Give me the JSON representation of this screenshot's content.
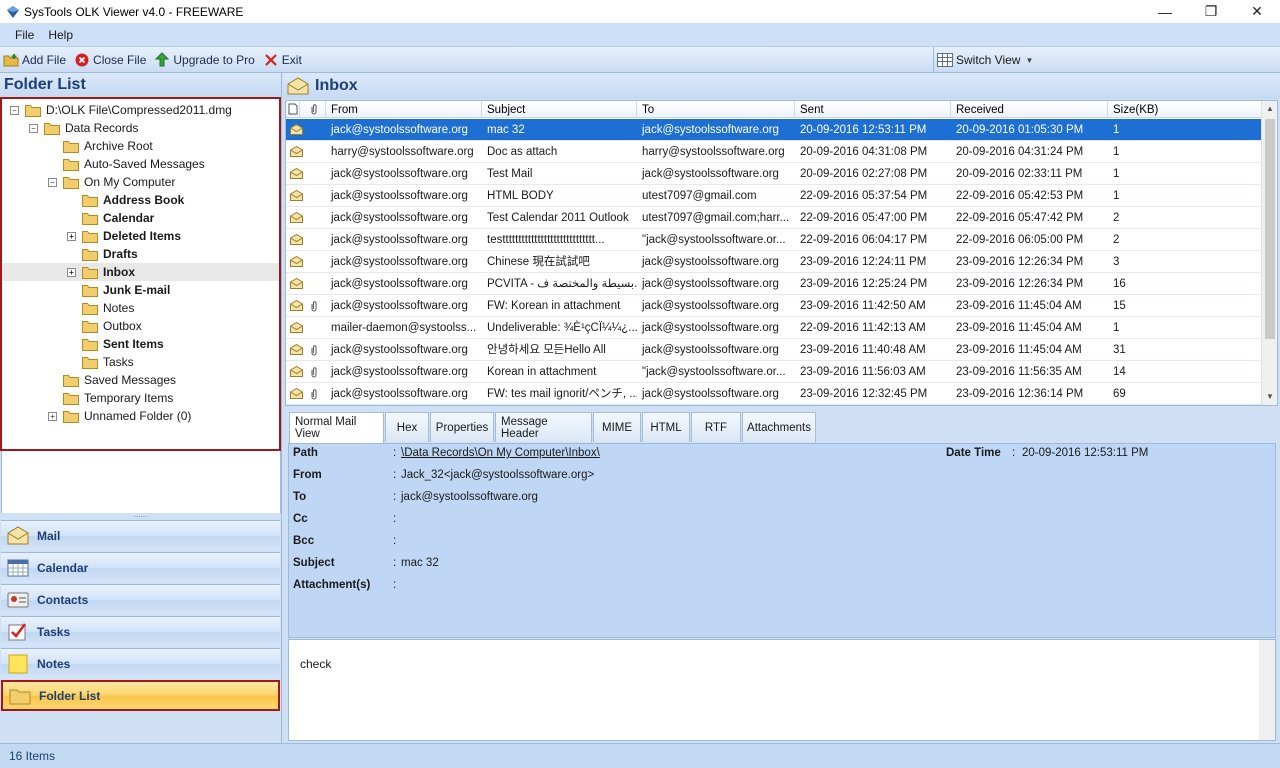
{
  "window": {
    "title": "SysTools OLK Viewer v4.0 - FREEWARE",
    "controls": [
      "—",
      "❐",
      "✕"
    ]
  },
  "menu": [
    "File",
    "Help"
  ],
  "toolbar": {
    "add_file": "Add File",
    "close_file": "Close File",
    "upgrade": "Upgrade to Pro",
    "exit": "Exit",
    "switch_view": "Switch View"
  },
  "folder_list": {
    "title": "Folder List",
    "items": [
      {
        "label": "D:\\OLK File\\Compressed2011.dmg",
        "level": 0,
        "expander": "−",
        "bold": false
      },
      {
        "label": "Data Records",
        "level": 1,
        "expander": "−",
        "bold": false
      },
      {
        "label": "Archive Root",
        "level": 2,
        "expander": "",
        "bold": false
      },
      {
        "label": "Auto-Saved Messages",
        "level": 2,
        "expander": "",
        "bold": false
      },
      {
        "label": "On My Computer",
        "level": 2,
        "expander": "−",
        "bold": false
      },
      {
        "label": "Address Book",
        "level": 3,
        "expander": "",
        "bold": true
      },
      {
        "label": "Calendar",
        "level": 3,
        "expander": "",
        "bold": true
      },
      {
        "label": "Deleted Items",
        "level": 3,
        "expander": "+",
        "bold": true
      },
      {
        "label": "Drafts",
        "level": 3,
        "expander": "",
        "bold": true
      },
      {
        "label": "Inbox",
        "level": 3,
        "expander": "+",
        "bold": true,
        "selected": true
      },
      {
        "label": "Junk E-mail",
        "level": 3,
        "expander": "",
        "bold": true
      },
      {
        "label": "Notes",
        "level": 3,
        "expander": "",
        "bold": false
      },
      {
        "label": "Outbox",
        "level": 3,
        "expander": "",
        "bold": false
      },
      {
        "label": "Sent Items",
        "level": 3,
        "expander": "",
        "bold": true
      },
      {
        "label": "Tasks",
        "level": 3,
        "expander": "",
        "bold": false
      },
      {
        "label": "Saved Messages",
        "level": 2,
        "expander": "",
        "bold": false
      },
      {
        "label": "Temporary Items",
        "level": 2,
        "expander": "",
        "bold": false
      },
      {
        "label": "Unnamed Folder (0)",
        "level": 2,
        "expander": "+",
        "bold": false
      }
    ]
  },
  "nav": {
    "splitter": "......",
    "buttons": [
      "Mail",
      "Calendar",
      "Contacts",
      "Tasks",
      "Notes",
      "Folder List"
    ],
    "active": "Folder List"
  },
  "inbox": {
    "title": "Inbox",
    "columns": [
      "From",
      "Subject",
      "To",
      "Sent",
      "Received",
      "Size(KB)"
    ],
    "rows": [
      {
        "from": "jack@systoolssoftware.org",
        "subject": "mac 32",
        "to": "jack@systoolssoftware.org",
        "sent": "20-09-2016 12:53:11 PM",
        "received": "20-09-2016 01:05:30 PM",
        "size": "1",
        "attach": false
      },
      {
        "from": "harry@systoolssoftware.org",
        "subject": "Doc as attach",
        "to": "harry@systoolssoftware.org",
        "sent": "20-09-2016 04:31:08 PM",
        "received": "20-09-2016 04:31:24 PM",
        "size": "1",
        "attach": false
      },
      {
        "from": "jack@systoolssoftware.org",
        "subject": "Test Mail",
        "to": "jack@systoolssoftware.org",
        "sent": "20-09-2016 02:27:08 PM",
        "received": "20-09-2016 02:33:11 PM",
        "size": "1",
        "attach": false
      },
      {
        "from": "jack@systoolssoftware.org",
        "subject": "HTML BODY",
        "to": "utest7097@gmail.com",
        "sent": "22-09-2016 05:37:54 PM",
        "received": "22-09-2016 05:42:53 PM",
        "size": "1",
        "attach": false
      },
      {
        "from": "jack@systoolssoftware.org",
        "subject": "Test Calendar 2011 Outlook",
        "to": "utest7097@gmail.com;harr...",
        "sent": "22-09-2016 05:47:00 PM",
        "received": "22-09-2016 05:47:42 PM",
        "size": "2",
        "attach": false
      },
      {
        "from": "jack@systoolssoftware.org",
        "subject": "testtttttttttttttttttttttttttttt...",
        "to": "\"jack@systoolssoftware.or...",
        "sent": "22-09-2016 06:04:17 PM",
        "received": "22-09-2016 06:05:00 PM",
        "size": "2",
        "attach": false
      },
      {
        "from": "jack@systoolssoftware.org",
        "subject": "Chinese 現在試試吧",
        "to": "jack@systoolssoftware.org",
        "sent": "23-09-2016 12:24:11 PM",
        "received": "23-09-2016 12:26:34 PM",
        "size": "3",
        "attach": false
      },
      {
        "from": "jack@systoolssoftware.org",
        "subject": "PCVITA - بسيطة والمختصة ف...",
        "to": "jack@systoolssoftware.org",
        "sent": "23-09-2016 12:25:24 PM",
        "received": "23-09-2016 12:26:34 PM",
        "size": "16",
        "attach": false
      },
      {
        "from": "jack@systoolssoftware.org",
        "subject": "FW: Korean in attachment",
        "to": "jack@systoolssoftware.org",
        "sent": "23-09-2016 11:42:50 AM",
        "received": "23-09-2016 11:45:04 AM",
        "size": "15",
        "attach": true
      },
      {
        "from": "mailer-daemon@systoolss...",
        "subject": "Undeliverable: ¾È¹çCÏ¼¼¿...",
        "to": "jack@systoolssoftware.org",
        "sent": "22-09-2016 11:42:13 AM",
        "received": "23-09-2016 11:45:04 AM",
        "size": "1",
        "attach": false
      },
      {
        "from": "jack@systoolssoftware.org",
        "subject": "안녕하세요 모든Hello  All",
        "to": "jack@systoolssoftware.org",
        "sent": "23-09-2016 11:40:48 AM",
        "received": "23-09-2016 11:45:04 AM",
        "size": "31",
        "attach": true
      },
      {
        "from": "jack@systoolssoftware.org",
        "subject": "Korean in attachment",
        "to": "\"jack@systoolssoftware.or...",
        "sent": "23-09-2016 11:56:03 AM",
        "received": "23-09-2016 11:56:35 AM",
        "size": "14",
        "attach": true
      },
      {
        "from": "jack@systoolssoftware.org",
        "subject": "FW: tes mail ignorit/ペンチ, ...",
        "to": "jack@systoolssoftware.org",
        "sent": "23-09-2016 12:32:45 PM",
        "received": "23-09-2016 12:36:14 PM",
        "size": "69",
        "attach": true
      }
    ]
  },
  "tabs": [
    "Normal Mail View",
    "Hex",
    "Properties",
    "Message Header",
    "MIME",
    "HTML",
    "RTF",
    "Attachments"
  ],
  "detail": {
    "path_label": "Path",
    "path_value": "\\Data Records\\On My Computer\\Inbox\\",
    "datetime_label": "Date Time",
    "datetime_value": "20-09-2016 12:53:11 PM",
    "from_label": "From",
    "from_value": "Jack_32<jack@systoolssoftware.org>",
    "to_label": "To",
    "to_value": "jack@systoolssoftware.org",
    "cc_label": "Cc",
    "cc_value": "",
    "bcc_label": "Bcc",
    "bcc_value": "",
    "subject_label": "Subject",
    "subject_value": "mac 32",
    "attach_label": "Attachment(s)",
    "attach_value": "",
    "colon": ":"
  },
  "body_text": "check",
  "status": "16 Items",
  "colors": {
    "selection": "#1e6fd4",
    "highlight_border": "#a01818",
    "active_nav": "#fbd36b"
  }
}
